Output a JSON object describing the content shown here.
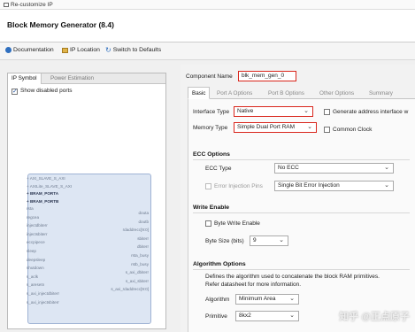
{
  "window": {
    "title": "Re-customize IP"
  },
  "header": {
    "title": "Block Memory Generator (8.4)"
  },
  "toolbar": {
    "documentation": "Documentation",
    "ip_location": "IP Location",
    "switch_defaults": "Switch to Defaults"
  },
  "left": {
    "tabs": [
      "IP Symbol",
      "Power Estimation"
    ],
    "show_disabled_ports": "Show disabled ports",
    "symbol_left_pins": [
      "+ AXI_SLAVE_S_AXI",
      "+ AXILite_SLAVE_S_AXI",
      "+ BRAM_PORTA",
      "+ BRAM_PORTB",
      "rsta",
      "regcea",
      "injectdbiterr",
      "injectsbiterr",
      "eccpipece",
      "sleep",
      "deepsleep",
      "shutdown",
      "s_aclk",
      "s_aresetn",
      "s_axi_injectdbiterr",
      "s_axi_injectsbiterr"
    ],
    "symbol_right_pins": [
      "douta",
      "doutb",
      "rdaddrecc[9:0]",
      "sbiterr",
      "dbiterr",
      "rsta_busy",
      "rstb_busy",
      "s_axi_dbiterr",
      "s_axi_sbiterr",
      "s_axi_rdaddrecc[9:0]"
    ]
  },
  "component_name": {
    "label": "Component Name",
    "value": "blk_mem_gen_0"
  },
  "tabs": [
    "Basic",
    "Port A Options",
    "Port B Options",
    "Other Options",
    "Summary"
  ],
  "basic": {
    "interface_type": {
      "label": "Interface Type",
      "value": "Native"
    },
    "generate_address": "Generate address interface w",
    "memory_type": {
      "label": "Memory Type",
      "value": "Simple Dual Port RAM"
    },
    "common_clock": "Common Clock",
    "ecc_options": {
      "title": "ECC Options",
      "ecc_type": {
        "label": "ECC Type",
        "value": "No ECC"
      },
      "error_injection": {
        "label": "Error Injection Pins",
        "value": "Single Bit Error Injection"
      }
    },
    "write_enable": {
      "title": "Write Enable",
      "byte_write_enable": "Byte Write Enable",
      "byte_size": {
        "label": "Byte Size (bits)",
        "value": "9"
      }
    },
    "algorithm_options": {
      "title": "Algorithm Options",
      "description": "Defines the algorithm used to concatenate the block RAM primitives.",
      "refer": "Refer datasheet for more information.",
      "algorithm": {
        "label": "Algorithm",
        "value": "Minimum Area"
      },
      "primitive": {
        "label": "Primitive",
        "value": "8kx2"
      }
    }
  },
  "watermark": "知乎 @正点原子",
  "colors": {
    "highlight": "#d9261c",
    "symbol_fill": "#dde6f3"
  }
}
